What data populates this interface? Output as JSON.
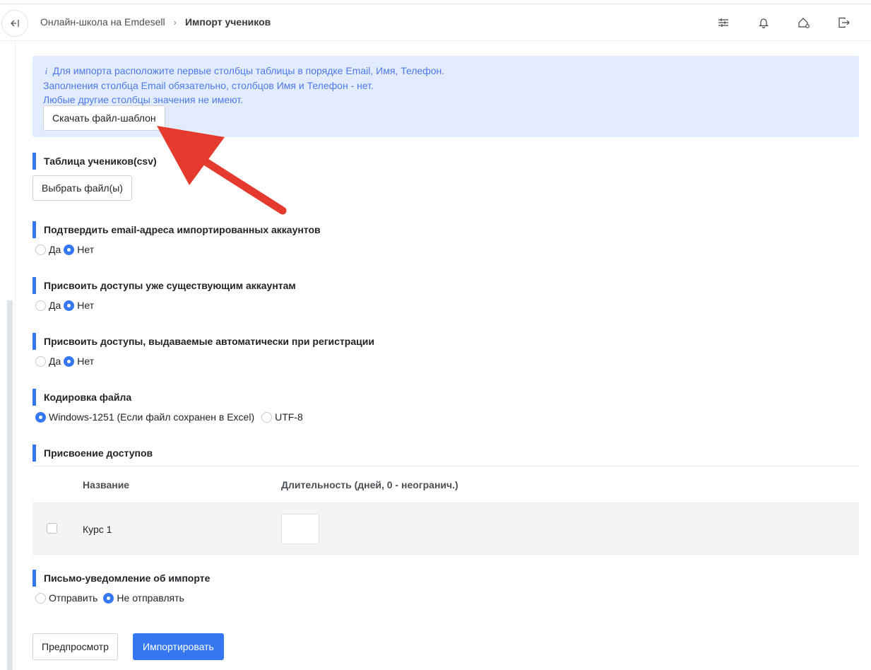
{
  "header": {
    "collapse_icon": "collapse-sidebar-icon",
    "breadcrumb": [
      "Онлайн-школа на Emdesell",
      "Импорт учеников"
    ],
    "icons": [
      "sliders-icon",
      "bell-icon",
      "home-settings-icon",
      "logout-icon"
    ]
  },
  "alert": {
    "icon": "i",
    "line1": "Для импорта расположите первые столбцы таблицы в порядке Email, Имя, Телефон.",
    "line2": "Заполнения столбца Email обязательно, столбцов Имя и Телефон - нет.",
    "line3": "Любые другие столбцы значения не имеют.",
    "download_button": "Скачать файл-шаблон"
  },
  "file_section": {
    "title": "Таблица учеников(csv)",
    "choose_button": "Выбрать файл(ы)"
  },
  "confirm_email": {
    "title": "Подтвердить email-адреса импортированных аккаунтов",
    "yes": "Да",
    "no": "Нет",
    "selected": "no"
  },
  "assign_existing": {
    "title": "Присвоить доступы уже существующим аккаунтам",
    "yes": "Да",
    "no": "Нет",
    "selected": "no"
  },
  "assign_auto": {
    "title": "Присвоить доступы, выдаваемые автоматически при регистрации",
    "yes": "Да",
    "no": "Нет",
    "selected": "no"
  },
  "encoding": {
    "title": "Кодировка файла",
    "win": "Windows-1251 (Если файл сохранен в Excel)",
    "utf": "UTF-8",
    "selected": "win"
  },
  "access": {
    "title": "Присвоение доступов",
    "col_name": "Название",
    "col_duration": "Длительность (дней, 0 - неогранич.)",
    "rows": [
      {
        "name": "Курс 1",
        "duration": ""
      }
    ]
  },
  "notify": {
    "title": "Письмо-уведомление об импорте",
    "send": "Отправить",
    "nosend": "Не отправлять",
    "selected": "nosend"
  },
  "actions": {
    "preview": "Предпросмотр",
    "import": "Импортировать"
  },
  "colors": {
    "accent": "#3577f1",
    "alert_bg": "#e2ecfe",
    "arrow": "#e53b2f"
  }
}
